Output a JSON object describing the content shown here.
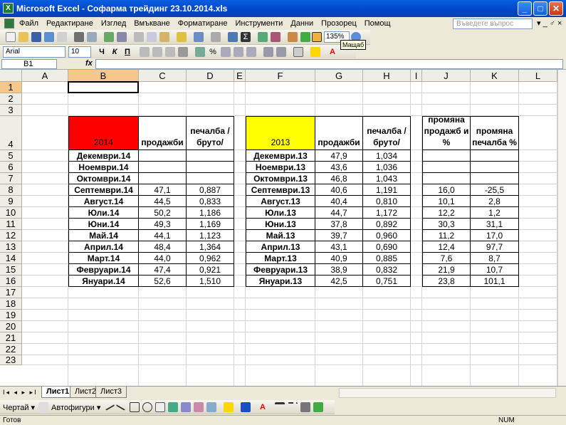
{
  "window": {
    "title": "Microsoft Excel - Софарма трейдинг 23.10.2014.xls",
    "icon": "excel-icon",
    "minimize_glyph": "_",
    "maximize_glyph": "□",
    "close_glyph": "✕"
  },
  "menubar": {
    "items": [
      "Файл",
      "Редактиране",
      "Изглед",
      "Вмъкване",
      "Форматиране",
      "Инструменти",
      "Данни",
      "Прозорец",
      "Помощ"
    ],
    "help_placeholder": "Въведете въпрос",
    "mdi_glyphs": "▾ _ ♂ ×"
  },
  "toolbar": {
    "zoom": "135%",
    "zoom_tooltip": "Мащаб",
    "font_name": "Arial",
    "font_size": "10"
  },
  "formula_bar": {
    "name_box": "B1",
    "fx": "fx",
    "content": ""
  },
  "columns": [
    "A",
    "B",
    "C",
    "D",
    "E",
    "F",
    "G",
    "H",
    "I",
    "J",
    "K",
    "L"
  ],
  "rows": [
    "1",
    "2",
    "3",
    "4",
    "5",
    "6",
    "7",
    "8",
    "9",
    "10",
    "11",
    "12",
    "13",
    "14",
    "15",
    "16",
    "17",
    "18",
    "19",
    "20",
    "21",
    "22",
    "23"
  ],
  "table2014": {
    "header": "2014",
    "header_color": "#ff0000",
    "col_sales": "продажби",
    "col_profit": "печалба /бруто/",
    "months": [
      "Декември.14",
      "Ноември.14",
      "Октомври.14",
      "Септември.14",
      "Август.14",
      "Юли.14",
      "Юни.14",
      "Май.14",
      "Април.14",
      "Март.14",
      "Февруари.14",
      "Януари.14"
    ],
    "sales": [
      "",
      "",
      "",
      "47,1",
      "44,5",
      "50,2",
      "49,3",
      "44,1",
      "48,4",
      "44,0",
      "47,4",
      "52,6"
    ],
    "profit": [
      "",
      "",
      "",
      "0,887",
      "0,833",
      "1,186",
      "1,169",
      "1,123",
      "1,364",
      "0,962",
      "0,921",
      "1,510"
    ]
  },
  "table2013": {
    "header": "2013",
    "header_color": "#ffff00",
    "col_sales": "продажби",
    "col_profit": "печалба /бруто/",
    "months": [
      "Декември.13",
      "Ноември.13",
      "Октомври.13",
      "Септември.13",
      "Август.13",
      "Юли.13",
      "Юни.13",
      "Май.13",
      "Април.13",
      "Март.13",
      "Февруари.13",
      "Януари.13"
    ],
    "sales": [
      "47,9",
      "43,6",
      "46,8",
      "40,6",
      "40,4",
      "44,7",
      "37,8",
      "39,7",
      "43,1",
      "40,9",
      "38,9",
      "42,5"
    ],
    "profit": [
      "1,034",
      "1,036",
      "1,043",
      "1,191",
      "0,810",
      "1,172",
      "0,892",
      "0,960",
      "0,690",
      "0,885",
      "0,832",
      "0,751"
    ]
  },
  "change": {
    "col_sales": "промяна продажб и %",
    "col_profit": "промяна печалба %",
    "sales": [
      "",
      "",
      "",
      "16,0",
      "10,1",
      "12,2",
      "30,3",
      "11,2",
      "12,4",
      "7,6",
      "21,9",
      "23,8"
    ],
    "profit": [
      "",
      "",
      "",
      "-25,5",
      "2,8",
      "1,2",
      "31,1",
      "17,0",
      "97,7",
      "8,7",
      "10,7",
      "101,1"
    ]
  },
  "sheet_tabs": [
    "Лист1",
    "Лист2",
    "Лист3"
  ],
  "tab_nav": "I◂ ◂ ▸ ▸I",
  "drawing_toolbar": {
    "draw_label": "Чертай ▾",
    "autoshapes_label": "Автофигури ▾"
  },
  "status": {
    "ready": "Готов",
    "num": "NUM"
  }
}
